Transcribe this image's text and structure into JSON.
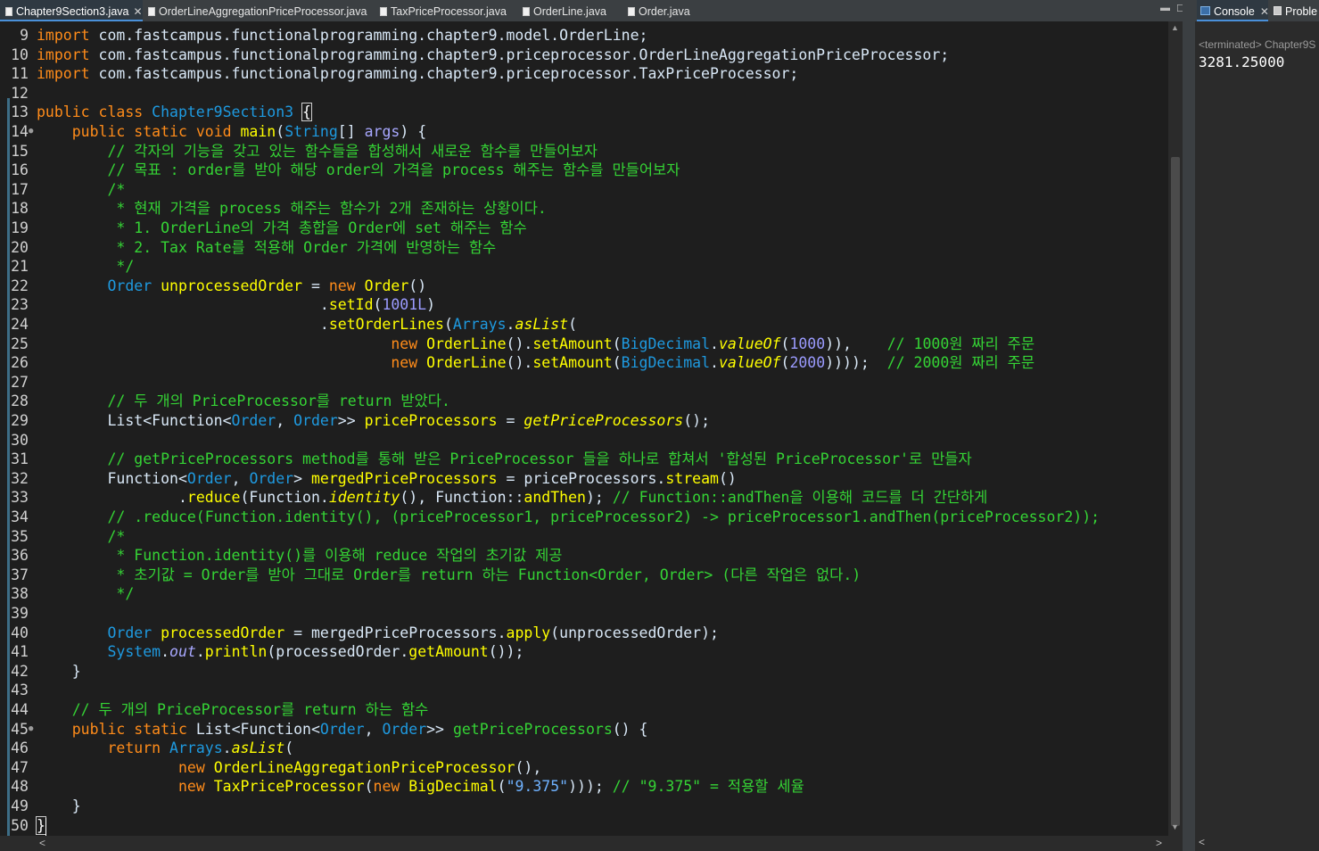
{
  "editor_tabs": [
    {
      "label": "Chapter9Section3.java",
      "active": true
    },
    {
      "label": "OrderLineAggregationPriceProcessor.java"
    },
    {
      "label": "TaxPriceProcessor.java"
    },
    {
      "label": "OrderLine.java"
    },
    {
      "label": "Order.java"
    }
  ],
  "console": {
    "tab_label": "Console",
    "tab2_label": "Proble",
    "status": "<terminated> Chapter9S",
    "output": "3281.25000"
  },
  "colors": {
    "keyword": "#ff8c1a",
    "type": "#1e9ae0",
    "method": "#ffff00",
    "comment": "#35d435",
    "number": "#9b9bff",
    "string": "#6fb2ff",
    "plain": "#d9e8f7",
    "static_field": "#a8a8ff",
    "bracket": "#ffffff"
  },
  "code": [
    {
      "n": "9",
      "tokens": [
        [
          "import",
          "keyword"
        ],
        [
          " com.fastcampus.functionalprogramming.chapter9.model.OrderLine;",
          "plain"
        ]
      ]
    },
    {
      "n": "10",
      "tokens": [
        [
          "import",
          "keyword"
        ],
        [
          " com.fastcampus.functionalprogramming.chapter9.priceprocessor.OrderLineAggregationPriceProcessor;",
          "plain"
        ]
      ]
    },
    {
      "n": "11",
      "tokens": [
        [
          "import",
          "keyword"
        ],
        [
          " com.fastcampus.functionalprogramming.chapter9.priceprocessor.TaxPriceProcessor;",
          "plain"
        ]
      ]
    },
    {
      "n": "12",
      "tokens": []
    },
    {
      "n": "13",
      "tokens": [
        [
          "public class ",
          "keyword"
        ],
        [
          "Chapter9Section3",
          "type"
        ],
        [
          " ",
          "plain"
        ],
        [
          "{",
          "bracket"
        ]
      ]
    },
    {
      "n": "14",
      "fold": true,
      "tokens": [
        [
          "    ",
          "plain"
        ],
        [
          "public static void ",
          "keyword"
        ],
        [
          "main",
          "method"
        ],
        [
          "(",
          "plain"
        ],
        [
          "String",
          "type"
        ],
        [
          "[] ",
          "plain"
        ],
        [
          "args",
          "static_field"
        ],
        [
          ") {",
          "plain"
        ]
      ]
    },
    {
      "n": "15",
      "tokens": [
        [
          "        // 각자의 기능을 갖고 있는 함수들을 합성해서 새로운 함수를 만들어보자",
          "comment"
        ]
      ]
    },
    {
      "n": "16",
      "tokens": [
        [
          "        // 목표 : order를 받아 해당 order의 가격을 process 해주는 함수를 만들어보자",
          "comment"
        ]
      ]
    },
    {
      "n": "17",
      "tokens": [
        [
          "        /*",
          "comment"
        ]
      ]
    },
    {
      "n": "18",
      "tokens": [
        [
          "         * 현재 가격을 process 해주는 함수가 2개 존재하는 상황이다.",
          "comment"
        ]
      ]
    },
    {
      "n": "19",
      "tokens": [
        [
          "         * 1. OrderLine의 가격 총합을 Order에 set 해주는 함수",
          "comment"
        ]
      ]
    },
    {
      "n": "20",
      "tokens": [
        [
          "         * 2. Tax Rate를 적용해 Order 가격에 반영하는 함수",
          "comment"
        ]
      ]
    },
    {
      "n": "21",
      "tokens": [
        [
          "         */",
          "comment"
        ]
      ]
    },
    {
      "n": "22",
      "tokens": [
        [
          "        ",
          "plain"
        ],
        [
          "Order",
          "type"
        ],
        [
          " ",
          "plain"
        ],
        [
          "unprocessedOrder",
          "method"
        ],
        [
          " = ",
          "plain"
        ],
        [
          "new ",
          "keyword"
        ],
        [
          "Order",
          "method"
        ],
        [
          "()",
          "plain"
        ]
      ]
    },
    {
      "n": "23",
      "tokens": [
        [
          "                                .",
          "plain"
        ],
        [
          "setId",
          "method"
        ],
        [
          "(",
          "plain"
        ],
        [
          "1001L",
          "number"
        ],
        [
          ")",
          "plain"
        ]
      ]
    },
    {
      "n": "24",
      "tokens": [
        [
          "                                .",
          "plain"
        ],
        [
          "setOrderLines",
          "method"
        ],
        [
          "(",
          "plain"
        ],
        [
          "Arrays",
          "type"
        ],
        [
          ".",
          "plain"
        ],
        [
          "asList",
          "method"
        ],
        [
          "(",
          "plain"
        ]
      ]
    },
    {
      "n": "25",
      "tokens": [
        [
          "                                        ",
          "plain"
        ],
        [
          "new ",
          "keyword"
        ],
        [
          "OrderLine",
          "method"
        ],
        [
          "().",
          "plain"
        ],
        [
          "setAmount",
          "method"
        ],
        [
          "(",
          "plain"
        ],
        [
          "BigDecimal",
          "type"
        ],
        [
          ".",
          "plain"
        ],
        [
          "valueOf",
          "method"
        ],
        [
          "(",
          "plain"
        ],
        [
          "1000",
          "number"
        ],
        [
          ")),    ",
          "plain"
        ],
        [
          "// 1000원 짜리 주문",
          "comment"
        ]
      ]
    },
    {
      "n": "26",
      "tokens": [
        [
          "                                        ",
          "plain"
        ],
        [
          "new ",
          "keyword"
        ],
        [
          "OrderLine",
          "method"
        ],
        [
          "().",
          "plain"
        ],
        [
          "setAmount",
          "method"
        ],
        [
          "(",
          "plain"
        ],
        [
          "BigDecimal",
          "type"
        ],
        [
          ".",
          "plain"
        ],
        [
          "valueOf",
          "method"
        ],
        [
          "(",
          "plain"
        ],
        [
          "2000",
          "number"
        ],
        [
          ")))); ",
          "plain"
        ],
        [
          " // 2000원 짜리 주문",
          "comment"
        ]
      ]
    },
    {
      "n": "27",
      "tokens": []
    },
    {
      "n": "28",
      "tokens": [
        [
          "        // 두 개의 PriceProcessor를 return 받았다.",
          "comment"
        ]
      ]
    },
    {
      "n": "29",
      "tokens": [
        [
          "        List<Function<",
          "plain"
        ],
        [
          "Order",
          "type"
        ],
        [
          ", ",
          "plain"
        ],
        [
          "Order",
          "type"
        ],
        [
          ">> ",
          "plain"
        ],
        [
          "priceProcessors",
          "method"
        ],
        [
          " = ",
          "plain"
        ],
        [
          "getPriceProcessors",
          "method"
        ],
        [
          "();",
          "plain"
        ]
      ]
    },
    {
      "n": "30",
      "tokens": []
    },
    {
      "n": "31",
      "tokens": [
        [
          "        // getPriceProcessors method를 통해 받은 PriceProcessor 들을 하나로 합쳐서 '합성된 PriceProcessor'로 만들자",
          "comment"
        ]
      ]
    },
    {
      "n": "32",
      "tokens": [
        [
          "        Function<",
          "plain"
        ],
        [
          "Order",
          "type"
        ],
        [
          ", ",
          "plain"
        ],
        [
          "Order",
          "type"
        ],
        [
          "> ",
          "plain"
        ],
        [
          "mergedPriceProcessors",
          "method"
        ],
        [
          " = priceProcessors.",
          "plain"
        ],
        [
          "stream",
          "method"
        ],
        [
          "()",
          "plain"
        ]
      ]
    },
    {
      "n": "33",
      "tokens": [
        [
          "                .",
          "plain"
        ],
        [
          "reduce",
          "method"
        ],
        [
          "(Function.",
          "plain"
        ],
        [
          "identity",
          "method"
        ],
        [
          "(), Function::",
          "plain"
        ],
        [
          "andThen",
          "method"
        ],
        [
          "); ",
          "plain"
        ],
        [
          "// Function::andThen을 이용해 코드를 더 간단하게",
          "comment"
        ]
      ]
    },
    {
      "n": "34",
      "tokens": [
        [
          "        // .reduce(Function.identity(), (priceProcessor1, priceProcessor2) -> priceProcessor1.andThen(priceProcessor2));",
          "comment"
        ]
      ]
    },
    {
      "n": "35",
      "tokens": [
        [
          "        /*",
          "comment"
        ]
      ]
    },
    {
      "n": "36",
      "tokens": [
        [
          "         * Function.identity()를 이용해 reduce 작업의 초기값 제공",
          "comment"
        ]
      ]
    },
    {
      "n": "37",
      "tokens": [
        [
          "         * 초기값 = Order를 받아 그대로 Order를 return 하는 Function<Order, Order> (다른 작업은 없다.)",
          "comment"
        ]
      ]
    },
    {
      "n": "38",
      "tokens": [
        [
          "         */",
          "comment"
        ]
      ]
    },
    {
      "n": "39",
      "tokens": []
    },
    {
      "n": "40",
      "tokens": [
        [
          "        ",
          "plain"
        ],
        [
          "Order",
          "type"
        ],
        [
          " ",
          "plain"
        ],
        [
          "processedOrder",
          "method"
        ],
        [
          " = mergedPriceProcessors.",
          "plain"
        ],
        [
          "apply",
          "method"
        ],
        [
          "(unprocessedOrder);",
          "plain"
        ]
      ]
    },
    {
      "n": "41",
      "tokens": [
        [
          "        ",
          "plain"
        ],
        [
          "System",
          "type"
        ],
        [
          ".",
          "plain"
        ],
        [
          "out",
          "static_field"
        ],
        [
          ".",
          "plain"
        ],
        [
          "println",
          "method"
        ],
        [
          "(processedOrder.",
          "plain"
        ],
        [
          "getAmount",
          "method"
        ],
        [
          "());",
          "plain"
        ]
      ]
    },
    {
      "n": "42",
      "tokens": [
        [
          "    }",
          "plain"
        ]
      ]
    },
    {
      "n": "43",
      "tokens": []
    },
    {
      "n": "44",
      "tokens": [
        [
          "    // 두 개의 PriceProcessor를 return 하는 함수",
          "comment"
        ]
      ]
    },
    {
      "n": "45",
      "fold": true,
      "tokens": [
        [
          "    ",
          "plain"
        ],
        [
          "public static ",
          "keyword"
        ],
        [
          "List<Function<",
          "plain"
        ],
        [
          "Order",
          "type"
        ],
        [
          ", ",
          "plain"
        ],
        [
          "Order",
          "type"
        ],
        [
          ">> ",
          "plain"
        ],
        [
          "getPriceProcessors",
          "comment"
        ],
        [
          "() {",
          "plain"
        ]
      ]
    },
    {
      "n": "46",
      "tokens": [
        [
          "        ",
          "plain"
        ],
        [
          "return ",
          "keyword"
        ],
        [
          "Arrays",
          "type"
        ],
        [
          ".",
          "plain"
        ],
        [
          "asList",
          "method"
        ],
        [
          "(",
          "plain"
        ]
      ]
    },
    {
      "n": "47",
      "tokens": [
        [
          "                ",
          "plain"
        ],
        [
          "new ",
          "keyword"
        ],
        [
          "OrderLineAggregationPriceProcessor",
          "method"
        ],
        [
          "(),",
          "plain"
        ]
      ]
    },
    {
      "n": "48",
      "tokens": [
        [
          "                ",
          "plain"
        ],
        [
          "new ",
          "keyword"
        ],
        [
          "TaxPriceProcessor",
          "method"
        ],
        [
          "(",
          "plain"
        ],
        [
          "new ",
          "keyword"
        ],
        [
          "BigDecimal",
          "method"
        ],
        [
          "(",
          "plain"
        ],
        [
          "\"9.375\"",
          "string"
        ],
        [
          "))); ",
          "plain"
        ],
        [
          "// \"9.375\" = 적용할 세율",
          "comment"
        ]
      ]
    },
    {
      "n": "49",
      "tokens": [
        [
          "    }",
          "plain"
        ]
      ]
    },
    {
      "n": "50",
      "tokens": [
        [
          "}",
          "bracket"
        ]
      ]
    }
  ]
}
